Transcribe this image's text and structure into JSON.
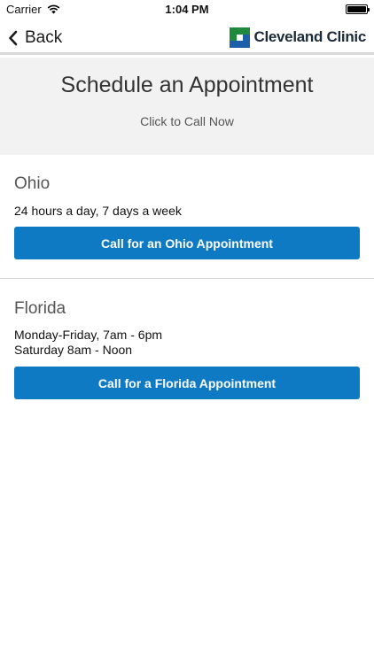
{
  "status_bar": {
    "carrier": "Carrier",
    "time": "1:04 PM",
    "battery_level": 1.0
  },
  "nav": {
    "back_label": "Back",
    "logo_text": "Cleveland Clinic",
    "logo_colors": {
      "green": "#1f8a3e",
      "blue": "#1d5fa8"
    }
  },
  "header": {
    "title": "Schedule an Appointment",
    "subtitle": "Click to Call Now"
  },
  "regions": [
    {
      "name": "Ohio",
      "hours": [
        "24 hours a day, 7 days a week"
      ],
      "button_label": "Call for an Ohio Appointment"
    },
    {
      "name": "Florida",
      "hours": [
        "Monday-Friday, 7am - 6pm",
        "Saturday 8am - Noon"
      ],
      "button_label": "Call for a Florida Appointment"
    }
  ],
  "colors": {
    "accent": "#0e7ac4",
    "header_bg": "#f2f2f2"
  }
}
